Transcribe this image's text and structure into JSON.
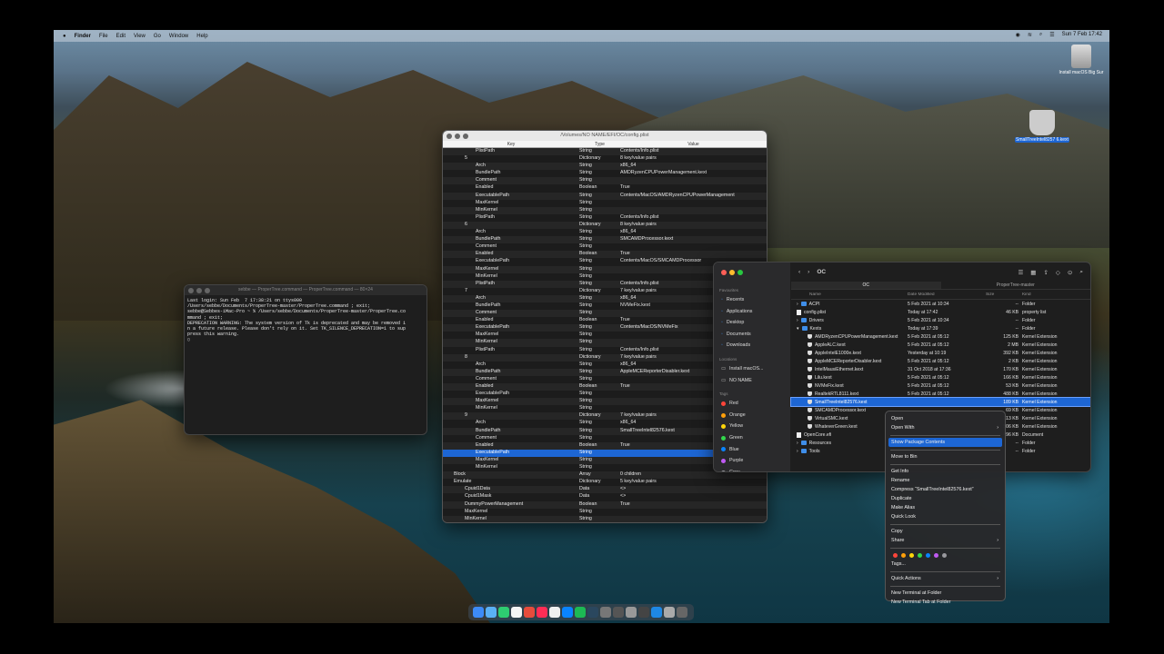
{
  "menubar": {
    "apple": "",
    "app": "Finder",
    "items": [
      "File",
      "Edit",
      "View",
      "Go",
      "Window",
      "Help"
    ],
    "clock": "Sun 7 Feb  17:42"
  },
  "desktop": {
    "icons": [
      {
        "label": "Install macOS Big Sur"
      },
      {
        "label": "SmallTreeIntel8257 6.kext"
      }
    ]
  },
  "terminal": {
    "title": "sebbe — ProperTree.command — ProperTree.command — 80×24",
    "lines": "Last login: Sun Feb  7 17:38:21 on ttys000\n/Users/sebbe/Documents/ProperTree-master/ProperTree.command ; exit;\nsebbe@Sebbes-iMac-Pro ~ % /Users/sebbe/Documents/ProperTree-master/ProperTree.co\nmmand ; exit;\nDEPRECATION WARNING: The system version of Tk is deprecated and may be removed i\nn a future release. Please don't rely on it. Set TK_SILENCE_DEPRECATION=1 to sup\npress this warning.\n▯"
  },
  "plist": {
    "title": "/Volumes/NO NAME/EFI/OC/config.plist",
    "headers": {
      "key": "Key",
      "type": "Type",
      "value": "Value"
    },
    "rows": [
      {
        "k": "PlistPath",
        "i": 3,
        "t": "String",
        "v": "Contents/Info.plist"
      },
      {
        "k": "5",
        "i": 2,
        "t": "Dictionary",
        "v": "8 key/value pairs"
      },
      {
        "k": "Arch",
        "i": 3,
        "t": "String",
        "v": "x86_64"
      },
      {
        "k": "BundlePath",
        "i": 3,
        "t": "String",
        "v": "AMDRyzenCPUPowerManagement.kext"
      },
      {
        "k": "Comment",
        "i": 3,
        "t": "String",
        "v": ""
      },
      {
        "k": "Enabled",
        "i": 3,
        "t": "Boolean",
        "v": "True"
      },
      {
        "k": "ExecutablePath",
        "i": 3,
        "t": "String",
        "v": "Contents/MacOS/AMDRyzenCPUPowerManagement"
      },
      {
        "k": "MaxKernel",
        "i": 3,
        "t": "String",
        "v": ""
      },
      {
        "k": "MinKernel",
        "i": 3,
        "t": "String",
        "v": ""
      },
      {
        "k": "PlistPath",
        "i": 3,
        "t": "String",
        "v": "Contents/Info.plist"
      },
      {
        "k": "6",
        "i": 2,
        "t": "Dictionary",
        "v": "8 key/value pairs"
      },
      {
        "k": "Arch",
        "i": 3,
        "t": "String",
        "v": "x86_64"
      },
      {
        "k": "BundlePath",
        "i": 3,
        "t": "String",
        "v": "SMCAMDProcessor.kext"
      },
      {
        "k": "Comment",
        "i": 3,
        "t": "String",
        "v": ""
      },
      {
        "k": "Enabled",
        "i": 3,
        "t": "Boolean",
        "v": "True"
      },
      {
        "k": "ExecutablePath",
        "i": 3,
        "t": "String",
        "v": "Contents/MacOS/SMCAMDProcessor"
      },
      {
        "k": "MaxKernel",
        "i": 3,
        "t": "String",
        "v": ""
      },
      {
        "k": "MinKernel",
        "i": 3,
        "t": "String",
        "v": ""
      },
      {
        "k": "PlistPath",
        "i": 3,
        "t": "String",
        "v": "Contents/Info.plist"
      },
      {
        "k": "7",
        "i": 2,
        "t": "Dictionary",
        "v": "7 key/value pairs"
      },
      {
        "k": "Arch",
        "i": 3,
        "t": "String",
        "v": "x86_64"
      },
      {
        "k": "BundlePath",
        "i": 3,
        "t": "String",
        "v": "NVMeFix.kext"
      },
      {
        "k": "Comment",
        "i": 3,
        "t": "String",
        "v": ""
      },
      {
        "k": "Enabled",
        "i": 3,
        "t": "Boolean",
        "v": "True"
      },
      {
        "k": "ExecutablePath",
        "i": 3,
        "t": "String",
        "v": "Contents/MacOS/NVMeFix"
      },
      {
        "k": "MaxKernel",
        "i": 3,
        "t": "String",
        "v": ""
      },
      {
        "k": "MinKernel",
        "i": 3,
        "t": "String",
        "v": ""
      },
      {
        "k": "PlistPath",
        "i": 3,
        "t": "String",
        "v": "Contents/Info.plist"
      },
      {
        "k": "8",
        "i": 2,
        "t": "Dictionary",
        "v": "7 key/value pairs"
      },
      {
        "k": "Arch",
        "i": 3,
        "t": "String",
        "v": "x86_64"
      },
      {
        "k": "BundlePath",
        "i": 3,
        "t": "String",
        "v": "AppleMCEReporterDisabler.kext"
      },
      {
        "k": "Comment",
        "i": 3,
        "t": "String",
        "v": ""
      },
      {
        "k": "Enabled",
        "i": 3,
        "t": "Boolean",
        "v": "True"
      },
      {
        "k": "ExecutablePath",
        "i": 3,
        "t": "String",
        "v": ""
      },
      {
        "k": "MaxKernel",
        "i": 3,
        "t": "String",
        "v": ""
      },
      {
        "k": "MinKernel",
        "i": 3,
        "t": "String",
        "v": ""
      },
      {
        "k": "9",
        "i": 2,
        "t": "Dictionary",
        "v": "7 key/value pairs"
      },
      {
        "k": "Arch",
        "i": 3,
        "t": "String",
        "v": "x86_64"
      },
      {
        "k": "BundlePath",
        "i": 3,
        "t": "String",
        "v": "SmallTreeIntel82576.kext"
      },
      {
        "k": "Comment",
        "i": 3,
        "t": "String",
        "v": ""
      },
      {
        "k": "Enabled",
        "i": 3,
        "t": "Boolean",
        "v": "True"
      },
      {
        "k": "ExecutablePath",
        "i": 3,
        "t": "String",
        "v": "",
        "sel": true
      },
      {
        "k": "MaxKernel",
        "i": 3,
        "t": "String",
        "v": ""
      },
      {
        "k": "MinKernel",
        "i": 3,
        "t": "String",
        "v": ""
      },
      {
        "k": "Block",
        "i": 1,
        "t": "Array",
        "v": "0 children"
      },
      {
        "k": "Emulate",
        "i": 1,
        "t": "Dictionary",
        "v": "5 key/value pairs"
      },
      {
        "k": "Cpuid1Data",
        "i": 2,
        "t": "Data",
        "v": "<>"
      },
      {
        "k": "Cpuid1Mask",
        "i": 2,
        "t": "Data",
        "v": "<>"
      },
      {
        "k": "DummyPowerManagement",
        "i": 2,
        "t": "Boolean",
        "v": "True"
      },
      {
        "k": "MaxKernel",
        "i": 2,
        "t": "String",
        "v": ""
      },
      {
        "k": "MinKernel",
        "i": 2,
        "t": "String",
        "v": ""
      }
    ]
  },
  "finder": {
    "title": "OC",
    "sidebar": {
      "favorites_label": "Favourites",
      "favorites": [
        "Recents",
        "Applications",
        "Desktop",
        "Documents",
        "Downloads"
      ],
      "locations_label": "Locations",
      "locations": [
        "Install macOS...",
        "NO NAME"
      ],
      "tags_label": "Tags",
      "tags": [
        {
          "name": "Red",
          "color": "#ff453a"
        },
        {
          "name": "Orange",
          "color": "#ff9f0a"
        },
        {
          "name": "Yellow",
          "color": "#ffd60a"
        },
        {
          "name": "Green",
          "color": "#32d74b"
        },
        {
          "name": "Blue",
          "color": "#0a84ff"
        },
        {
          "name": "Purple",
          "color": "#bf5af2"
        },
        {
          "name": "Grey",
          "color": "#98989d"
        }
      ]
    },
    "tabs": [
      "OC",
      "ProperTree-master"
    ],
    "columns": {
      "name": "Name",
      "date": "Date Modified",
      "size": "Size",
      "kind": "Kind"
    },
    "rows": [
      {
        "n": "ACPI",
        "d": "5 Feb 2021 at 10:34",
        "s": "--",
        "k": "Folder",
        "ic": "folder",
        "lv": 0
      },
      {
        "n": "config.plist",
        "d": "Today at 17:42",
        "s": "46 KB",
        "k": "property list",
        "ic": "file",
        "lv": 0
      },
      {
        "n": "Drivers",
        "d": "5 Feb 2021 at 10:34",
        "s": "--",
        "k": "Folder",
        "ic": "folder",
        "lv": 0
      },
      {
        "n": "Kexts",
        "d": "Today at 17:39",
        "s": "--",
        "k": "Folder",
        "ic": "folder",
        "lv": 0
      },
      {
        "n": "AMDRyzenCPUPowerManagement.kext",
        "d": "5 Feb 2021 at 05:12",
        "s": "125 KB",
        "k": "Kernel Extension",
        "ic": "kext",
        "lv": 1
      },
      {
        "n": "AppleALC.kext",
        "d": "5 Feb 2021 at 05:12",
        "s": "2 MB",
        "k": "Kernel Extension",
        "ic": "kext",
        "lv": 1
      },
      {
        "n": "AppleIntelE1000e.kext",
        "d": "Yesterday at 10:19",
        "s": "392 KB",
        "k": "Kernel Extension",
        "ic": "kext",
        "lv": 1
      },
      {
        "n": "AppleMCEReporterDisabler.kext",
        "d": "5 Feb 2021 at 05:12",
        "s": "2 KB",
        "k": "Kernel Extension",
        "ic": "kext",
        "lv": 1
      },
      {
        "n": "IntelMausiEthernet.kext",
        "d": "31 Oct 2018 at 17:36",
        "s": "170 KB",
        "k": "Kernel Extension",
        "ic": "kext",
        "lv": 1
      },
      {
        "n": "Lilu.kext",
        "d": "5 Feb 2021 at 05:12",
        "s": "166 KB",
        "k": "Kernel Extension",
        "ic": "kext",
        "lv": 1
      },
      {
        "n": "NVMeFix.kext",
        "d": "5 Feb 2021 at 05:12",
        "s": "53 KB",
        "k": "Kernel Extension",
        "ic": "kext",
        "lv": 1
      },
      {
        "n": "RealtekRTL8111.kext",
        "d": "5 Feb 2021 at 05:12",
        "s": "488 KB",
        "k": "Kernel Extension",
        "ic": "kext",
        "lv": 1
      },
      {
        "n": "SmallTreeIntel82576.kext",
        "d": "",
        "s": "189 KB",
        "k": "Kernel Extension",
        "ic": "kext",
        "lv": 1,
        "sel": true
      },
      {
        "n": "SMCAMDProcessor.kext",
        "d": "",
        "s": "69 KB",
        "k": "Kernel Extension",
        "ic": "kext",
        "lv": 1
      },
      {
        "n": "VirtualSMC.kext",
        "d": "",
        "s": "113 KB",
        "k": "Kernel Extension",
        "ic": "kext",
        "lv": 1
      },
      {
        "n": "WhateverGreen.kext",
        "d": "",
        "s": "506 KB",
        "k": "Kernel Extension",
        "ic": "kext",
        "lv": 1
      },
      {
        "n": "OpenCore.efi",
        "d": "",
        "s": "496 KB",
        "k": "Document",
        "ic": "file",
        "lv": 0
      },
      {
        "n": "Resources",
        "d": "",
        "s": "--",
        "k": "Folder",
        "ic": "folder",
        "lv": 0
      },
      {
        "n": "Tools",
        "d": "",
        "s": "--",
        "k": "Folder",
        "ic": "folder",
        "lv": 0
      }
    ]
  },
  "context_menu": {
    "items": [
      {
        "l": "Open"
      },
      {
        "l": "Open With",
        "sub": true
      },
      {
        "sep": true
      },
      {
        "l": "Show Package Contents",
        "hl": true
      },
      {
        "sep": true
      },
      {
        "l": "Move to Bin"
      },
      {
        "sep": true
      },
      {
        "l": "Get Info"
      },
      {
        "l": "Rename"
      },
      {
        "l": "Compress “SmallTreeIntel82576.kext”"
      },
      {
        "l": "Duplicate"
      },
      {
        "l": "Make Alias"
      },
      {
        "l": "Quick Look"
      },
      {
        "sep": true
      },
      {
        "l": "Copy"
      },
      {
        "l": "Share",
        "sub": true
      },
      {
        "sep": true
      },
      {
        "tags": true
      },
      {
        "l": "Tags..."
      },
      {
        "sep": true
      },
      {
        "l": "Quick Actions",
        "sub": true
      },
      {
        "sep": true
      },
      {
        "l": "New Terminal at Folder"
      },
      {
        "l": "New Terminal Tab at Folder"
      }
    ],
    "tag_colors": [
      "#ff453a",
      "#ff9f0a",
      "#ffd60a",
      "#32d74b",
      "#0a84ff",
      "#bf5af2",
      "#98989d"
    ]
  },
  "dock": {
    "colors": [
      "#3d8bf7",
      "#5ab0f5",
      "#2ecc71",
      "#f5f5f5",
      "#e74c3c",
      "#ff2d55",
      "#f0f0f0",
      "#0a84ff",
      "#1db954",
      "#2a475e",
      "#777",
      "#555",
      "#999",
      "#444",
      "#1e88e5",
      "#aaa",
      "#666"
    ]
  }
}
